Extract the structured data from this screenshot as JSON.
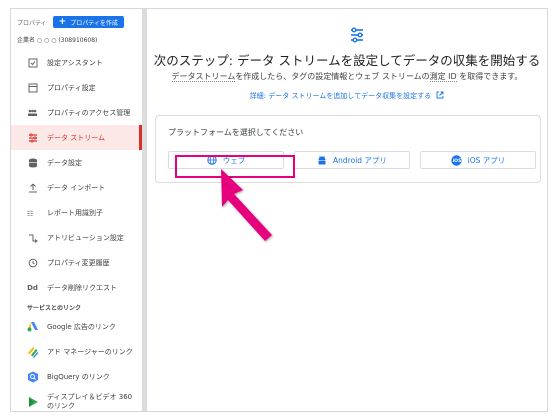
{
  "sidebar": {
    "property_label": "プロパティ",
    "create_button": "プロパティを作成",
    "account_name": "企業名 ○ ○ ○ (308910608)",
    "items": [
      {
        "label": "設定アシスタント",
        "icon": "checklist-icon"
      },
      {
        "label": "プロパティ設定",
        "icon": "property-settings-icon"
      },
      {
        "label": "プロパティのアクセス管理",
        "icon": "people-icon"
      },
      {
        "label": "データ ストリーム",
        "icon": "data-stream-icon",
        "active": true
      },
      {
        "label": "データ設定",
        "icon": "database-icon"
      },
      {
        "label": "データ インポート",
        "icon": "upload-icon"
      },
      {
        "label": "レポート用識別子",
        "icon": "identifier-icon"
      },
      {
        "label": "アトリビューション設定",
        "icon": "attribution-icon"
      },
      {
        "label": "プロパティ変更履歴",
        "icon": "history-icon"
      },
      {
        "label": "データ削除リクエスト",
        "icon": "dd-icon"
      }
    ],
    "links_section": "サービスとのリンク",
    "links": [
      {
        "label": "Google 広告のリンク",
        "icon": "google-ads-icon"
      },
      {
        "label": "アド マネージャーのリンク",
        "icon": "ad-manager-icon"
      },
      {
        "label": "BigQuery のリンク",
        "icon": "bigquery-icon"
      },
      {
        "label_line1": "ディスプレイ＆ビデオ 360",
        "label_line2": "のリンク",
        "icon": "dv360-icon"
      }
    ]
  },
  "main": {
    "heading": "次のステップ: データ ストリームを設定してデータの収集を開始する",
    "subtext_link": "データストリーム",
    "subtext_rest1": "を作成したら、タグの設定情報とウェブ ストリームの",
    "subtext_dotted": "測定 ID",
    "subtext_rest2": " を取得できます。",
    "detail_link": "詳細: データ ストリームを追加してデータ収集を設定する",
    "card_title": "プラットフォームを選択してください",
    "buttons": {
      "web": "ウェブ",
      "android": "Android アプリ",
      "ios": "iOS アプリ"
    }
  },
  "colors": {
    "accent": "#1a73e8",
    "active_nav": "#d93025",
    "highlight": "#e6007e"
  }
}
